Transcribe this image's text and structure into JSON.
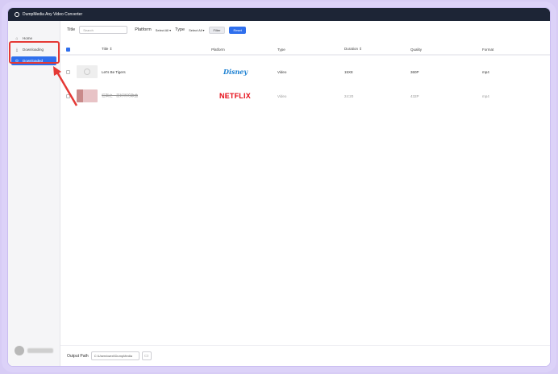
{
  "window": {
    "title": "DumpMedia Any Video Converter"
  },
  "sidebar": {
    "items": [
      {
        "label": "Home",
        "icon": "home-icon"
      },
      {
        "label": "Downloading",
        "icon": "download-icon"
      },
      {
        "label": "Downloaded",
        "icon": "check-circle-icon",
        "active": true
      }
    ]
  },
  "filters": {
    "title_label": "Title",
    "search_placeholder": "Search",
    "platform_label": "Platform",
    "platform_value": "Select All",
    "type_label": "Type",
    "type_value": "Select All",
    "filter_label": "Filter",
    "reset_label": "Reset"
  },
  "table": {
    "headers": [
      "Title ⇕",
      "Platform",
      "Type",
      "Duration ⇕",
      "Quality",
      "Format"
    ],
    "rows": [
      {
        "title": "Let's Be Tigers",
        "platform": "Disney",
        "type": "Video",
        "duration": "15X8",
        "quality": "360P",
        "format": "mp4"
      },
      {
        "title": "狂飙之一首好听的歌曲",
        "platform": "NETFLIX",
        "type": "Video",
        "duration": "24:20",
        "quality": "432P",
        "format": "mp4"
      }
    ]
  },
  "output": {
    "label": "Output Path",
    "path": "C:\\Users\\wexi\\DumpMedia"
  },
  "colors": {
    "accent": "#2f6fed",
    "titlebar": "#1d2536",
    "highlight": "#e53935"
  }
}
